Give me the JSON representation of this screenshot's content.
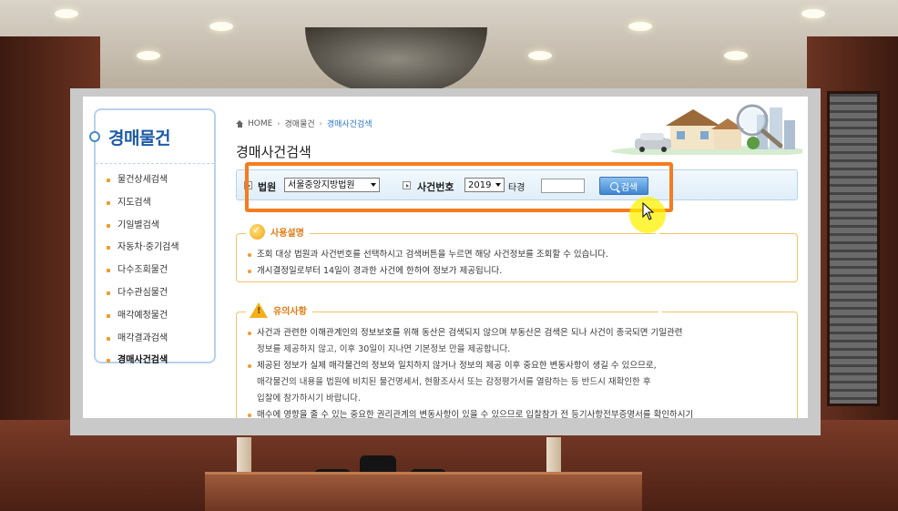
{
  "sidebar": {
    "title": "경매물건",
    "items": [
      {
        "label": "물건상세검색"
      },
      {
        "label": "지도검색"
      },
      {
        "label": "기일별검색"
      },
      {
        "label": "자동차·중기검색"
      },
      {
        "label": "다수조회물건"
      },
      {
        "label": "다수관심물건"
      },
      {
        "label": "매각예정물건"
      },
      {
        "label": "매각결과검색"
      },
      {
        "label": "경매사건검색"
      }
    ]
  },
  "breadcrumb": {
    "home": "HOME",
    "level1": "경매물건",
    "level2": "경매사건검색"
  },
  "page_title": "경매사건검색",
  "search": {
    "court_label": "법원",
    "court_value": "서울중앙지방법원",
    "case_label": "사건번호",
    "year_value": "2019",
    "case_type": "타경",
    "case_number": "",
    "button_label": "검색"
  },
  "usage": {
    "title": "사용설명",
    "lines": [
      "조회 대상 법원과 사건번호를 선택하시고 검색버튼을 누르면 해당 사건정보를 조회할 수 있습니다.",
      "개시결정일로부터 14일이 경과한 사건에 한하여 정보가 제공됩니다."
    ]
  },
  "notice": {
    "title": "유의사항",
    "items": [
      {
        "text": "사건과 관련한 이해관계인의 정보보호를 위해 동산은 검색되지 않으며 부동산은 검색은 되나 사건이 종국되면 기일관련",
        "cont": "정보를 제공하지 않고, 이후 30일이 지나면 기본정보 만을 제공합니다."
      },
      {
        "text": "제공된 정보가 실제 매각물건의 정보와 일치하지 않거나 정보의 제공 이후 중요한 변동사항이 생길 수 있으므로,",
        "cont": "매각물건의 내용을 법원에 비치된 물건명세서, 현황조사서 또는 감정평가서를 열람하는 등 반드시 재확인한 후",
        "cont2": "입찰에 참가하시기 바랍니다."
      },
      {
        "text": "매수에 영향을 줄 수 있는 중요한 권리관계의 변동사항이 있을 수 있으므로 입찰참가 전 등기사항전부증명서를 확인하시기",
        "cont": ""
      }
    ]
  },
  "colors": {
    "accent": "#f57c1f",
    "link": "#2a76c8",
    "sidebar_title": "#1d5aa8"
  }
}
